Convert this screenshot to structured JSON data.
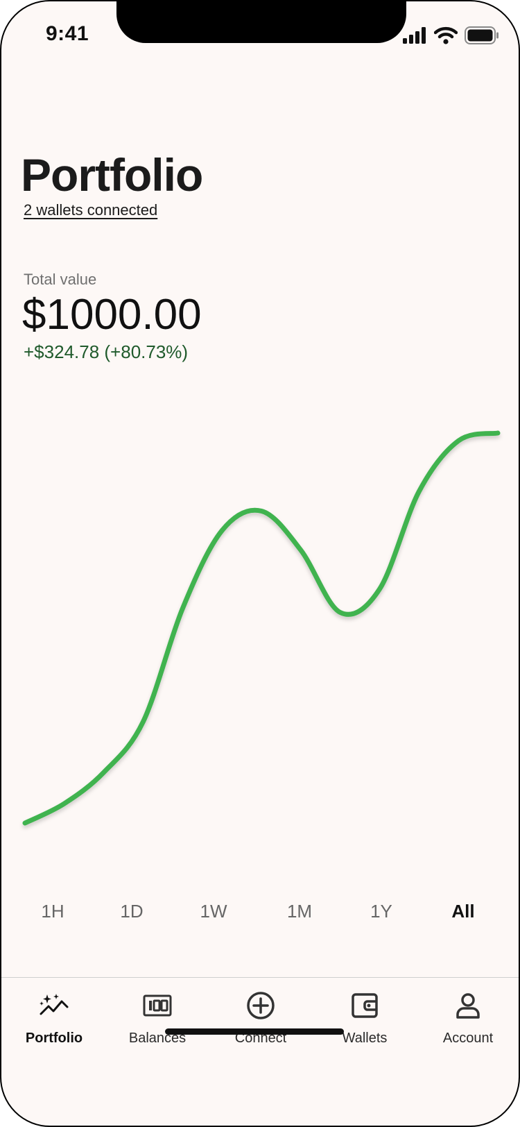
{
  "status_bar": {
    "time": "9:41",
    "icons": [
      "cellular-signal-icon",
      "wifi-icon",
      "battery-icon"
    ]
  },
  "header": {
    "title": "Portfolio",
    "wallets_link": "2 wallets connected"
  },
  "summary": {
    "total_label": "Total value",
    "total_value": "$1000.00",
    "change": "+$324.78 (+80.73%)",
    "change_color": "#1f5a2b"
  },
  "chart_data": {
    "type": "line",
    "title": "",
    "xlabel": "",
    "ylabel": "",
    "line_color": "#3fb34f",
    "grid": false,
    "axes": false,
    "x": [
      0,
      1,
      2,
      3,
      4,
      5,
      6,
      7,
      8,
      9,
      10,
      11,
      12
    ],
    "series": [
      {
        "values": [
          0,
          0.05,
          0.13,
          0.26,
          0.55,
          0.75,
          0.8,
          0.7,
          0.54,
          0.6,
          0.85,
          0.98,
          1.0
        ]
      }
    ]
  },
  "time_ranges": {
    "options": [
      "1H",
      "1D",
      "1W",
      "1M",
      "1Y",
      "All"
    ],
    "selected": "All"
  },
  "tab_bar": {
    "active": "Portfolio",
    "items": [
      {
        "label": "Portfolio",
        "icon": "sparkle-chart-icon"
      },
      {
        "label": "Balances",
        "icon": "banknote-icon"
      },
      {
        "label": "Connect",
        "icon": "plus-circle-icon"
      },
      {
        "label": "Wallets",
        "icon": "wallet-icon"
      },
      {
        "label": "Account",
        "icon": "person-icon"
      }
    ]
  }
}
